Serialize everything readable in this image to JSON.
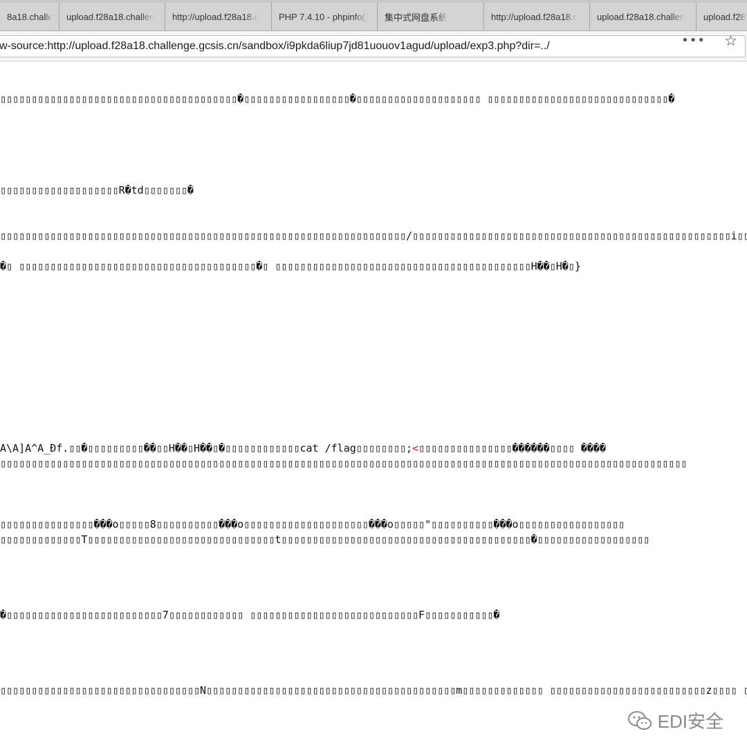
{
  "tabs": [
    {
      "label": "8a18.challen"
    },
    {
      "label": "upload.f28a18.challen"
    },
    {
      "label": "http://upload.f28a18.c"
    },
    {
      "label": "PHP 7.4.10 - phpinfo()"
    },
    {
      "label": "集中式网盘系统"
    },
    {
      "label": "http://upload.f28a18.c"
    },
    {
      "label": "upload.f28a18.challen"
    },
    {
      "label": "upload.f28"
    }
  ],
  "address": {
    "url": "w-source:http://upload.f28a18.challenge.gcsis.cn/sandbox/i9pkda6liup7jd81uouov1agud/upload/exp3.php?dir=../"
  },
  "toolbar": {
    "more_label": "•••",
    "star_label": "☆"
  },
  "source": {
    "line1": "▯▯▯▯▯▯▯▯▯▯▯▯▯▯▯▯▯▯▯▯▯▯▯▯▯▯▯▯▯▯▯▯▯▯▯▯▯▯�▯▯▯▯▯▯▯▯▯▯▯▯▯▯▯▯▯�▯▯▯▯▯▯▯▯▯▯▯▯▯▯▯▯▯▯▯▯ ▯▯▯▯▯▯▯▯▯▯▯▯▯▯▯▯▯▯▯▯▯▯▯▯▯▯▯▯▯�",
    "line2": "▯▯▯▯▯▯▯▯▯▯▯▯▯▯▯▯▯▯▯R�td▯▯▯▯▯▯▯�",
    "line3": "▯▯▯▯▯▯▯▯▯▯▯▯▯▯▯▯▯▯▯▯▯▯▯▯▯▯▯▯▯▯▯▯▯▯▯▯▯▯▯▯▯▯▯▯▯▯▯▯▯▯▯▯▯▯▯▯▯▯▯▯▯▯▯▯▯/▯▯▯▯▯▯▯▯▯▯▯▯▯▯▯▯▯▯▯▯▯▯▯▯▯▯▯▯▯▯▯▯▯▯▯▯▯▯▯▯▯▯▯▯▯▯▯▯▯▯▯i▯▯▯▯ ▯▯▯▯▯▯▯▯▯▯▯▯▯▯▯▯▯▯▯",
    "line4": "�▯ ▯▯▯▯▯▯▯▯▯▯▯▯▯▯▯▯▯▯▯▯▯▯▯▯▯▯▯▯▯▯▯▯▯▯▯▯▯▯�▯ ▯▯▯▯▯▯▯▯▯▯▯▯▯▯▯▯▯▯▯▯▯▯▯▯▯▯▯▯▯▯▯▯▯▯▯▯▯▯▯▯▯H��▯H�▯}",
    "line5_pre": "A\\A]A^A_Ðf.▯▯�▯▯▯▯▯▯▯▯▯��▯▯H��▯H��▯�▯▯▯▯▯▯▯▯▯▯▯▯cat /flag▯▯▯▯▯▯▯▯;",
    "line5_tag": "<",
    "line5_post": "▯▯▯▯▯▯▯▯▯▯▯▯▯▯▯������▯▯▯▯ ����",
    "line6": "▯▯▯▯▯▯▯▯▯▯▯▯▯▯▯▯▯▯▯▯▯▯▯▯▯▯▯▯▯▯▯▯▯▯▯▯▯▯▯▯▯▯▯▯▯▯▯▯▯▯▯▯▯▯▯▯▯▯▯▯▯▯▯▯▯▯▯▯▯▯▯▯▯▯▯▯▯▯▯▯▯▯▯▯▯▯▯▯▯▯▯▯▯▯▯▯▯▯▯▯▯▯▯▯▯▯▯▯▯▯",
    "line7": "▯▯▯▯▯▯▯▯▯▯▯▯▯▯▯���o▯▯▯▯▯8▯▯▯▯▯▯▯▯▯▯���o▯▯▯▯▯▯▯▯▯▯▯▯▯▯▯▯▯▯▯▯���o▯▯▯▯▯\"▯▯▯▯▯▯▯▯▯▯���o▯▯▯▯▯▯▯▯▯▯▯▯▯▯▯▯▯",
    "line8": "▯▯▯▯▯▯▯▯▯▯▯▯▯T▯▯▯▯▯▯▯▯▯▯▯▯▯▯▯▯▯▯▯▯▯▯▯▯▯▯▯▯▯▯t▯▯▯▯▯▯▯▯▯▯▯▯▯▯▯▯▯▯▯▯▯▯▯▯▯▯▯▯▯▯▯▯▯▯▯▯▯▯▯▯�▯▯▯▯▯▯▯▯▯▯▯▯▯▯▯▯▯▯",
    "line9": "�▯▯▯▯▯▯▯▯▯▯▯▯▯▯▯▯▯▯▯▯▯▯▯▯▯7▯▯▯▯▯▯▯▯▯▯▯▯ ▯▯▯▯▯▯▯▯▯▯▯▯▯▯▯▯▯▯▯▯▯▯▯▯▯▯▯F▯▯▯▯▯▯▯▯▯▯▯�",
    "line10": "▯▯▯▯▯▯▯▯▯▯▯▯▯▯▯▯▯▯▯▯▯▯▯▯▯▯▯▯▯▯▯▯N▯▯▯▯▯▯▯▯▯▯▯▯▯▯▯▯▯▯▯▯▯▯▯▯▯▯▯▯▯▯▯▯▯▯▯▯▯▯▯▯m▯▯▯▯▯▯▯▯▯▯▯▯▯ ▯▯▯▯▯▯▯▯▯▯▯▯▯▯▯▯▯▯▯▯▯▯▯▯▯z▯▯▯▯ ▯▯▯▯▯▯▯▯▯▯▯"
  },
  "watermark": {
    "text": "EDI安全",
    "icon": "wechat-icon"
  }
}
